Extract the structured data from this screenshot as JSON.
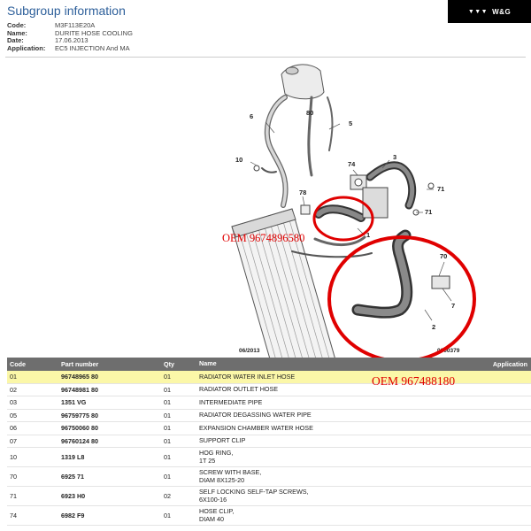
{
  "header": {
    "title": "Subgroup information",
    "fields": [
      {
        "label": "Code:",
        "value": "M3F113E20A"
      },
      {
        "label": "Name:",
        "value": "DURITE HOSE COOLING"
      },
      {
        "label": "Date:",
        "value": "17.06.2013"
      },
      {
        "label": "Application:",
        "value": "EC5 INJECTION And MA"
      }
    ],
    "logo_text": "W&G",
    "logo_icon": "wg-logo-icon"
  },
  "diagram": {
    "date_label": "06/2013",
    "ref_label": "0000379",
    "callouts": {
      "c1": "1",
      "c2": "2",
      "c3": "3",
      "c5": "5",
      "c6": "6",
      "c7": "7",
      "c10": "10",
      "c70": "70",
      "c71a": "71",
      "c71b": "71",
      "c74": "74",
      "c78": "78",
      "c80": "80"
    },
    "oem_annotation_1": "OEM 9674896580",
    "oem_annotation_2": "OEM 967488180",
    "highlight_color": "#e00000"
  },
  "table": {
    "columns": [
      "Code",
      "Part number",
      "Qty",
      "Name",
      "Application"
    ],
    "rows": [
      {
        "code": "01",
        "part": "96748965 80",
        "qty": "01",
        "name": "RADIATOR WATER INLET HOSE",
        "name2": "",
        "highlight": true
      },
      {
        "code": "02",
        "part": "96748981 80",
        "qty": "01",
        "name": "RADIATOR OUTLET HOSE",
        "name2": ""
      },
      {
        "code": "03",
        "part": "1351 VG",
        "qty": "01",
        "name": "INTERMEDIATE PIPE",
        "name2": ""
      },
      {
        "code": "05",
        "part": "96759775 80",
        "qty": "01",
        "name": "RADIATOR DEGASSING WATER PIPE",
        "name2": ""
      },
      {
        "code": "06",
        "part": "96750060 80",
        "qty": "01",
        "name": "EXPANSION CHAMBER WATER HOSE",
        "name2": ""
      },
      {
        "code": "07",
        "part": "96760124 80",
        "qty": "01",
        "name": "SUPPORT CLIP",
        "name2": ""
      },
      {
        "code": "10",
        "part": "1319 L8",
        "qty": "01",
        "name": "HOG RING,",
        "name2": "1T 25"
      },
      {
        "code": "70",
        "part": "6925 71",
        "qty": "01",
        "name": "SCREW WITH BASE,",
        "name2": "DIAM 8X125-20"
      },
      {
        "code": "71",
        "part": "6923 H0",
        "qty": "02",
        "name": "SELF LOCKING SELF-TAP SCREWS,",
        "name2": "6X100-16"
      },
      {
        "code": "74",
        "part": "6982 F9",
        "qty": "01",
        "name": "HOSE CLIP,",
        "name2": "DIAM 40"
      }
    ]
  }
}
